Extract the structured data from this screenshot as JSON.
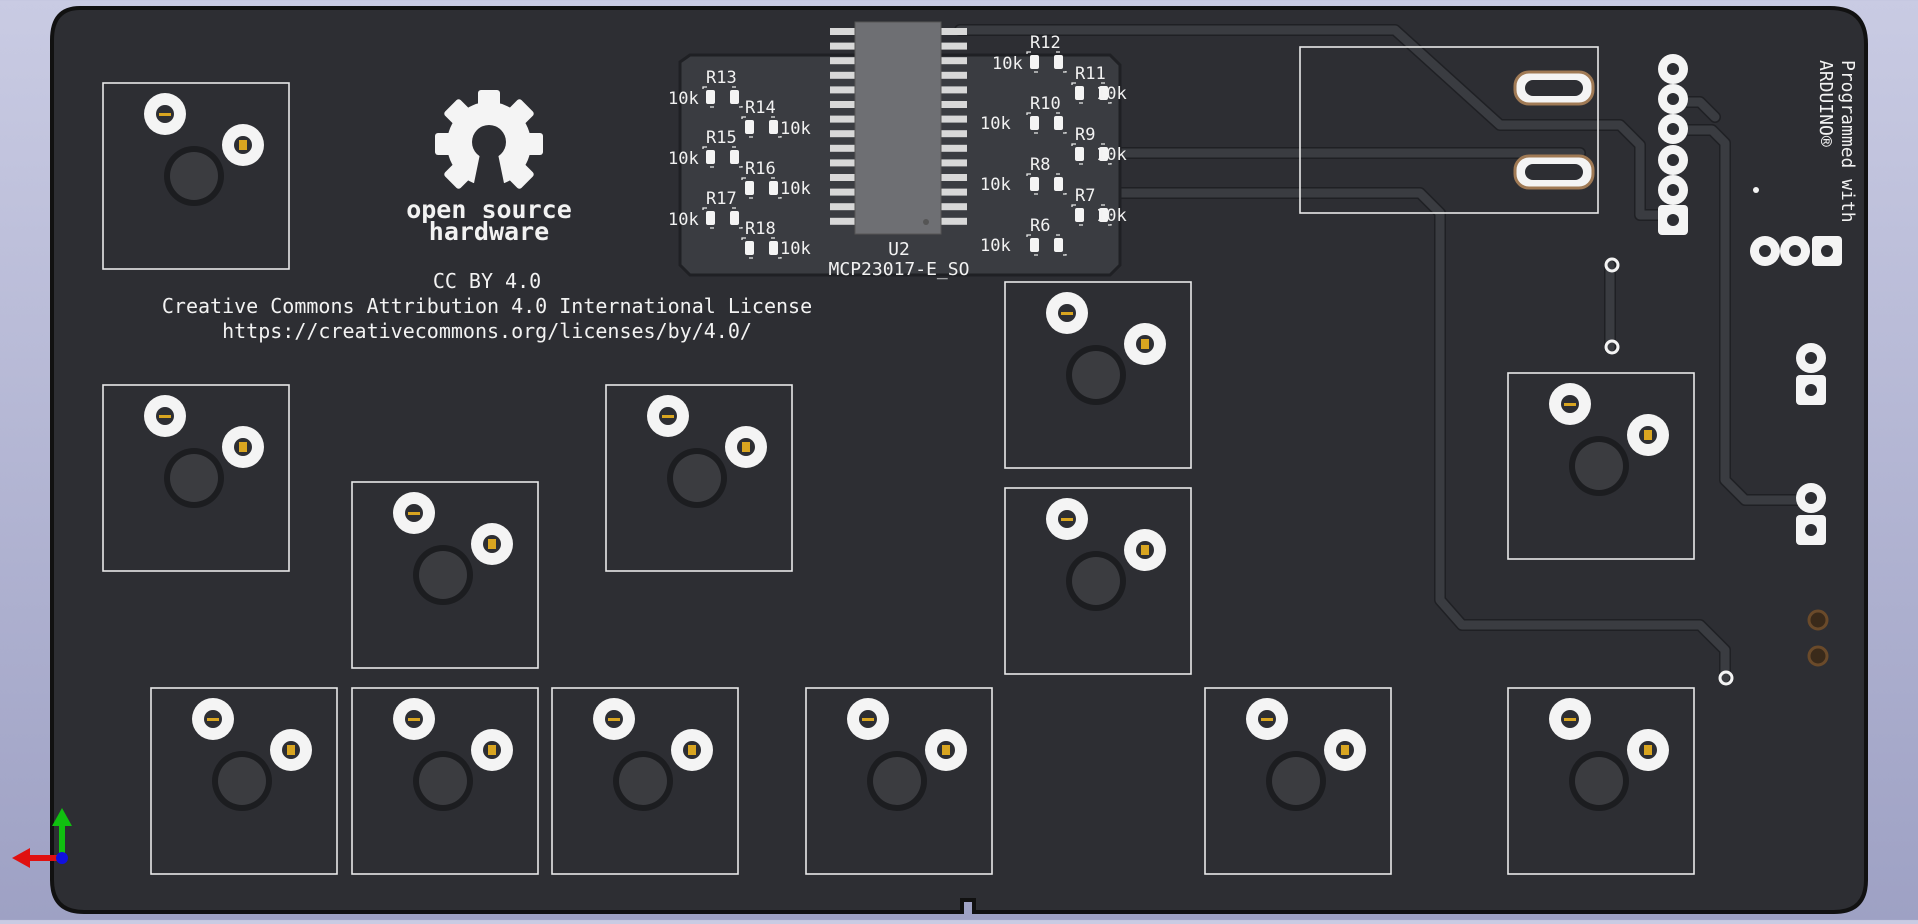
{
  "board": {
    "oshw_logo_text_line1": "open source",
    "oshw_logo_text_line2": "hardware",
    "license_short": "CC BY 4.0",
    "license_full": "Creative Commons Attribution 4.0 International License",
    "license_url": "https://creativecommons.org/licenses/by/4.0/",
    "programmed_line1": "Programmed with",
    "programmed_line2": "ARDUINO®",
    "ic_ref": "U2",
    "ic_value": "MCP23017-E_SO",
    "resistors": [
      {
        "ref": "R13",
        "value": "10k"
      },
      {
        "ref": "R14",
        "value": "10k"
      },
      {
        "ref": "R15",
        "value": "10k"
      },
      {
        "ref": "R16",
        "value": "10k"
      },
      {
        "ref": "R17",
        "value": "10k"
      },
      {
        "ref": "R18",
        "value": "10k"
      },
      {
        "ref": "R12",
        "value": "10k"
      },
      {
        "ref": "R11",
        "value": "10k"
      },
      {
        "ref": "R10",
        "value": "10k"
      },
      {
        "ref": "R9",
        "value": "10k"
      },
      {
        "ref": "R8",
        "value": "10k"
      },
      {
        "ref": "R7",
        "value": "10k"
      },
      {
        "ref": "R6",
        "value": "10k"
      }
    ]
  },
  "colors": {
    "board": "#2d2e33",
    "silkscreen": "#e8e8e8",
    "pad": "#f4f4f4",
    "gold": "#d9a520",
    "background_top": "#c9cbe3",
    "background_bottom": "#9ea1c4",
    "axis_x": "#e01010",
    "axis_y": "#10c010",
    "axis_z": "#1010e0"
  }
}
